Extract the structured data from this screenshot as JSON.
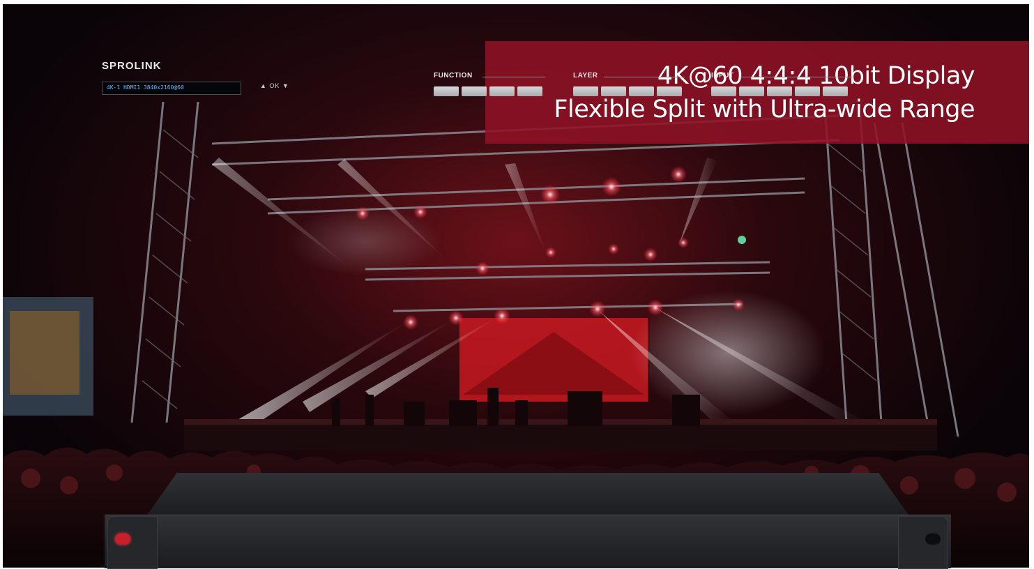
{
  "banner": {
    "line1": "4K@60 4:4:4 10bit Display",
    "line2": "Flexible Split with Ultra-wide Range"
  },
  "device": {
    "brand": "SPROLINK",
    "lcd_text": "4K-1  HDMI1   3840x2160@60",
    "nav_text": "▲  OK  ▼",
    "groups": {
      "function": "FUNCTION",
      "layer": "LAYER",
      "input": "INPUT"
    }
  },
  "colors": {
    "banner_bg": "#8e1226",
    "stage_red": "#d21e2c"
  }
}
